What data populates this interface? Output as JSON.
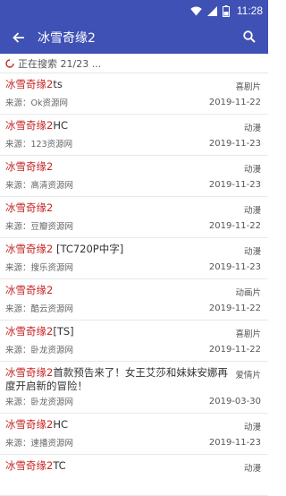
{
  "status_bar": {
    "time": "11:28"
  },
  "app_bar": {
    "title": "冰雪奇缘2"
  },
  "progress": {
    "text": "正在搜索 21/23 ..."
  },
  "results": [
    {
      "keyword": "冰雪奇缘2",
      "rest": "ts",
      "type": "喜剧片",
      "source": "来源：Ok资源网",
      "date": "2019-11-22"
    },
    {
      "keyword": "冰雪奇缘2",
      "rest": "HC",
      "type": "动漫",
      "source": "来源：123资源网",
      "date": "2019-11-23"
    },
    {
      "keyword": "冰雪奇缘2",
      "rest": "",
      "type": "动漫",
      "source": "来源：高清资源网",
      "date": "2019-11-23"
    },
    {
      "keyword": "冰雪奇缘2",
      "rest": "",
      "type": "动漫",
      "source": "来源：豆瓣资源网",
      "date": "2019-11-22"
    },
    {
      "keyword": "冰雪奇缘2",
      "rest": " [TC720P中字]",
      "type": "动漫",
      "source": "来源：搜乐资源网",
      "date": "2019-11-23"
    },
    {
      "keyword": "冰雪奇缘2",
      "rest": "",
      "type": "动画片",
      "source": "来源：酷云资源网",
      "date": "2019-11-22"
    },
    {
      "keyword": "冰雪奇缘2",
      "rest": "[TS]",
      "type": "喜剧片",
      "source": "来源：卧龙资源网",
      "date": "2019-11-22"
    },
    {
      "keyword": "冰雪奇缘2",
      "rest": "首款预告来了！女王艾莎和妹妹安娜再度开启新的冒险！",
      "type": "爱情片",
      "source": "来源：卧龙资源网",
      "date": "2019-03-30"
    },
    {
      "keyword": "冰雪奇缘2",
      "rest": "HC",
      "type": "动漫",
      "source": "来源：速播资源网",
      "date": "2019-11-23"
    },
    {
      "keyword": "冰雪奇缘2",
      "rest": "TC",
      "type": "动漫",
      "source": "",
      "date": ""
    }
  ],
  "icons": {
    "back": "arrow-left-icon",
    "search": "search-icon",
    "wifi": "wifi-icon",
    "signal": "signal-icon",
    "battery": "battery-icon",
    "spinner": "refresh-spinner-icon"
  },
  "colors": {
    "primary": "#3f51b5",
    "keyword": "#c62828"
  }
}
